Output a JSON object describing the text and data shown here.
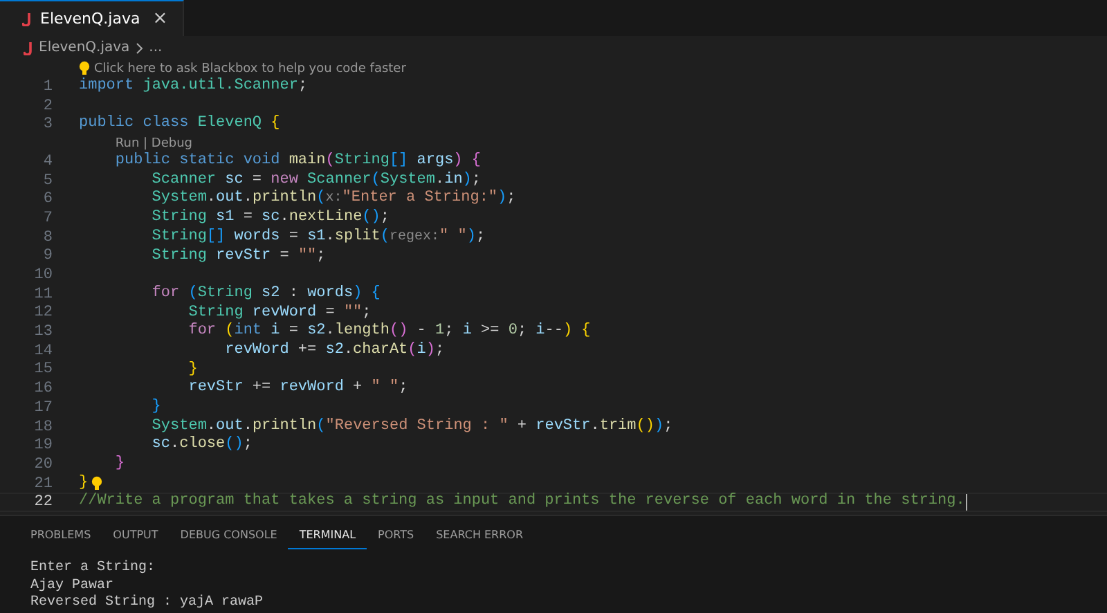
{
  "editor_tabs": [
    {
      "label": "ElevenQ.java",
      "selected": true,
      "close": "×"
    }
  ],
  "breadcrumb": {
    "file": "ElevenQ.java",
    "rest": "..."
  },
  "code": [
    {
      "kind": "lens",
      "text": "Click here to ask Blackbox to help you code faster",
      "lightbulb": true
    },
    {
      "kind": "line",
      "number": "1",
      "current": false,
      "lightbulb": false,
      "tokens": [
        {
          "kind": "keyword",
          "text": "import "
        },
        {
          "kind": "type",
          "text": "java.util.Scanner"
        },
        {
          "kind": "plain",
          "text": ";"
        }
      ]
    },
    {
      "kind": "line",
      "number": "2",
      "current": false,
      "lightbulb": false
    },
    {
      "kind": "line",
      "number": "3",
      "current": false,
      "lightbulb": false,
      "tokens": [
        {
          "kind": "keyword",
          "text": "public class "
        },
        {
          "kind": "type",
          "text": "ElevenQ "
        },
        {
          "kind": "bracket1",
          "text": "{"
        }
      ]
    },
    {
      "kind": "lens",
      "text": "Run | Debug",
      "lightbulb": false
    },
    {
      "kind": "line",
      "number": "4",
      "current": false,
      "lightbulb": false,
      "tokens": [
        {
          "kind": "keyword",
          "text": "    public static void "
        },
        {
          "kind": "function",
          "text": "main"
        },
        {
          "kind": "bracket2",
          "text": "("
        },
        {
          "kind": "type",
          "text": "String"
        },
        {
          "kind": "bracket3",
          "text": "[] "
        },
        {
          "kind": "variable",
          "text": "args"
        },
        {
          "kind": "bracket2",
          "text": ") {"
        }
      ]
    },
    {
      "kind": "line",
      "number": "5",
      "current": false,
      "lightbulb": false,
      "tokens": [
        {
          "kind": "type",
          "text": "        Scanner "
        },
        {
          "kind": "variable",
          "text": "sc"
        },
        {
          "kind": "plain",
          "text": " = "
        },
        {
          "kind": "control",
          "text": "new "
        },
        {
          "kind": "type",
          "text": "Scanner"
        },
        {
          "kind": "bracket3",
          "text": "("
        },
        {
          "kind": "type",
          "text": "System"
        },
        {
          "kind": "plain",
          "text": "."
        },
        {
          "kind": "variable",
          "text": "in"
        },
        {
          "kind": "bracket3",
          "text": ")"
        },
        {
          "kind": "plain",
          "text": ";"
        }
      ]
    },
    {
      "kind": "line",
      "number": "6",
      "current": false,
      "lightbulb": false,
      "tokens": [
        {
          "kind": "type",
          "text": "        System"
        },
        {
          "kind": "plain",
          "text": "."
        },
        {
          "kind": "variable",
          "text": "out"
        },
        {
          "kind": "plain",
          "text": "."
        },
        {
          "kind": "function",
          "text": "println"
        },
        {
          "kind": "bracket3",
          "text": "("
        },
        {
          "kind": "hint",
          "text": "x:"
        },
        {
          "kind": "string",
          "text": "\"Enter a String:\""
        },
        {
          "kind": "bracket3",
          "text": ")"
        },
        {
          "kind": "plain",
          "text": ";"
        }
      ]
    },
    {
      "kind": "line",
      "number": "7",
      "current": false,
      "lightbulb": false,
      "tokens": [
        {
          "kind": "type",
          "text": "        String "
        },
        {
          "kind": "variable",
          "text": "s1"
        },
        {
          "kind": "plain",
          "text": " = "
        },
        {
          "kind": "variable",
          "text": "sc"
        },
        {
          "kind": "plain",
          "text": "."
        },
        {
          "kind": "function",
          "text": "nextLine"
        },
        {
          "kind": "bracket3",
          "text": "()"
        },
        {
          "kind": "plain",
          "text": ";"
        }
      ]
    },
    {
      "kind": "line",
      "number": "8",
      "current": false,
      "lightbulb": false,
      "tokens": [
        {
          "kind": "type",
          "text": "        String"
        },
        {
          "kind": "bracket3",
          "text": "[] "
        },
        {
          "kind": "variable",
          "text": "words"
        },
        {
          "kind": "plain",
          "text": " = "
        },
        {
          "kind": "variable",
          "text": "s1"
        },
        {
          "kind": "plain",
          "text": "."
        },
        {
          "kind": "function",
          "text": "split"
        },
        {
          "kind": "bracket3",
          "text": "("
        },
        {
          "kind": "hint",
          "text": "regex:"
        },
        {
          "kind": "string",
          "text": "\" \""
        },
        {
          "kind": "bracket3",
          "text": ")"
        },
        {
          "kind": "plain",
          "text": ";"
        }
      ]
    },
    {
      "kind": "line",
      "number": "9",
      "current": false,
      "lightbulb": false,
      "tokens": [
        {
          "kind": "type",
          "text": "        String "
        },
        {
          "kind": "variable",
          "text": "revStr"
        },
        {
          "kind": "plain",
          "text": " = "
        },
        {
          "kind": "string",
          "text": "\"\""
        },
        {
          "kind": "plain",
          "text": ";"
        }
      ]
    },
    {
      "kind": "line",
      "number": "10",
      "current": false,
      "lightbulb": false
    },
    {
      "kind": "line",
      "number": "11",
      "current": false,
      "lightbulb": false,
      "tokens": [
        {
          "kind": "control",
          "text": "        for "
        },
        {
          "kind": "bracket3",
          "text": "("
        },
        {
          "kind": "type",
          "text": "String "
        },
        {
          "kind": "variable",
          "text": "s2"
        },
        {
          "kind": "plain",
          "text": " : "
        },
        {
          "kind": "variable",
          "text": "words"
        },
        {
          "kind": "bracket3",
          "text": ") {"
        }
      ]
    },
    {
      "kind": "line",
      "number": "12",
      "current": false,
      "lightbulb": false,
      "tokens": [
        {
          "kind": "type",
          "text": "            String "
        },
        {
          "kind": "variable",
          "text": "revWord"
        },
        {
          "kind": "plain",
          "text": " = "
        },
        {
          "kind": "string",
          "text": "\"\""
        },
        {
          "kind": "plain",
          "text": ";"
        }
      ]
    },
    {
      "kind": "line",
      "number": "13",
      "current": false,
      "lightbulb": false,
      "tokens": [
        {
          "kind": "control",
          "text": "            for "
        },
        {
          "kind": "bracket1",
          "text": "("
        },
        {
          "kind": "keyword",
          "text": "int "
        },
        {
          "kind": "variable",
          "text": "i"
        },
        {
          "kind": "plain",
          "text": " = "
        },
        {
          "kind": "variable",
          "text": "s2"
        },
        {
          "kind": "plain",
          "text": "."
        },
        {
          "kind": "function",
          "text": "length"
        },
        {
          "kind": "bracket2",
          "text": "()"
        },
        {
          "kind": "plain",
          "text": " - "
        },
        {
          "kind": "number",
          "text": "1"
        },
        {
          "kind": "plain",
          "text": "; "
        },
        {
          "kind": "variable",
          "text": "i"
        },
        {
          "kind": "plain",
          "text": " >= "
        },
        {
          "kind": "number",
          "text": "0"
        },
        {
          "kind": "plain",
          "text": "; "
        },
        {
          "kind": "variable",
          "text": "i"
        },
        {
          "kind": "plain",
          "text": "--"
        },
        {
          "kind": "bracket1",
          "text": ") {"
        }
      ]
    },
    {
      "kind": "line",
      "number": "14",
      "current": false,
      "lightbulb": false,
      "tokens": [
        {
          "kind": "variable",
          "text": "                revWord"
        },
        {
          "kind": "plain",
          "text": " += "
        },
        {
          "kind": "variable",
          "text": "s2"
        },
        {
          "kind": "plain",
          "text": "."
        },
        {
          "kind": "function",
          "text": "charAt"
        },
        {
          "kind": "bracket2",
          "text": "("
        },
        {
          "kind": "variable",
          "text": "i"
        },
        {
          "kind": "bracket2",
          "text": ")"
        },
        {
          "kind": "plain",
          "text": ";"
        }
      ]
    },
    {
      "kind": "line",
      "number": "15",
      "current": false,
      "lightbulb": false,
      "tokens": [
        {
          "kind": "bracket1",
          "text": "            }"
        }
      ]
    },
    {
      "kind": "line",
      "number": "16",
      "current": false,
      "lightbulb": false,
      "tokens": [
        {
          "kind": "variable",
          "text": "            revStr"
        },
        {
          "kind": "plain",
          "text": " += "
        },
        {
          "kind": "variable",
          "text": "revWord"
        },
        {
          "kind": "plain",
          "text": " + "
        },
        {
          "kind": "string",
          "text": "\" \""
        },
        {
          "kind": "plain",
          "text": ";"
        }
      ]
    },
    {
      "kind": "line",
      "number": "17",
      "current": false,
      "lightbulb": false,
      "tokens": [
        {
          "kind": "bracket3",
          "text": "        }"
        }
      ]
    },
    {
      "kind": "line",
      "number": "18",
      "current": false,
      "lightbulb": false,
      "tokens": [
        {
          "kind": "type",
          "text": "        System"
        },
        {
          "kind": "plain",
          "text": "."
        },
        {
          "kind": "variable",
          "text": "out"
        },
        {
          "kind": "plain",
          "text": "."
        },
        {
          "kind": "function",
          "text": "println"
        },
        {
          "kind": "bracket3",
          "text": "("
        },
        {
          "kind": "string",
          "text": "\"Reversed String : \""
        },
        {
          "kind": "plain",
          "text": " + "
        },
        {
          "kind": "variable",
          "text": "revStr"
        },
        {
          "kind": "plain",
          "text": "."
        },
        {
          "kind": "function",
          "text": "trim"
        },
        {
          "kind": "bracket1",
          "text": "()"
        },
        {
          "kind": "bracket3",
          "text": ")"
        },
        {
          "kind": "plain",
          "text": ";"
        }
      ]
    },
    {
      "kind": "line",
      "number": "19",
      "current": false,
      "lightbulb": false,
      "tokens": [
        {
          "kind": "variable",
          "text": "        sc"
        },
        {
          "kind": "plain",
          "text": "."
        },
        {
          "kind": "function",
          "text": "close"
        },
        {
          "kind": "bracket3",
          "text": "()"
        },
        {
          "kind": "plain",
          "text": ";"
        }
      ]
    },
    {
      "kind": "line",
      "number": "20",
      "current": false,
      "lightbulb": false,
      "tokens": [
        {
          "kind": "bracket2",
          "text": "    }"
        }
      ]
    },
    {
      "kind": "line",
      "number": "21",
      "current": false,
      "lightbulb": true,
      "tokens": [
        {
          "kind": "bracket1",
          "text": "}"
        }
      ]
    },
    {
      "kind": "line",
      "number": "22",
      "current": true,
      "lightbulb": false,
      "tokens": [
        {
          "kind": "comment",
          "text": "//Write a program that takes a string as input and prints the reverse of each word in the string."
        }
      ]
    }
  ],
  "panel_tabs": [
    {
      "label": "PROBLEMS",
      "selected": false
    },
    {
      "label": "OUTPUT",
      "selected": false
    },
    {
      "label": "DEBUG CONSOLE",
      "selected": false
    },
    {
      "label": "TERMINAL",
      "selected": true
    },
    {
      "label": "PORTS",
      "selected": false
    },
    {
      "label": "SEARCH ERROR",
      "selected": false
    }
  ],
  "terminal": [
    "Enter a String:",
    "Ajay Pawar",
    "Reversed String : yajA rawaP"
  ]
}
